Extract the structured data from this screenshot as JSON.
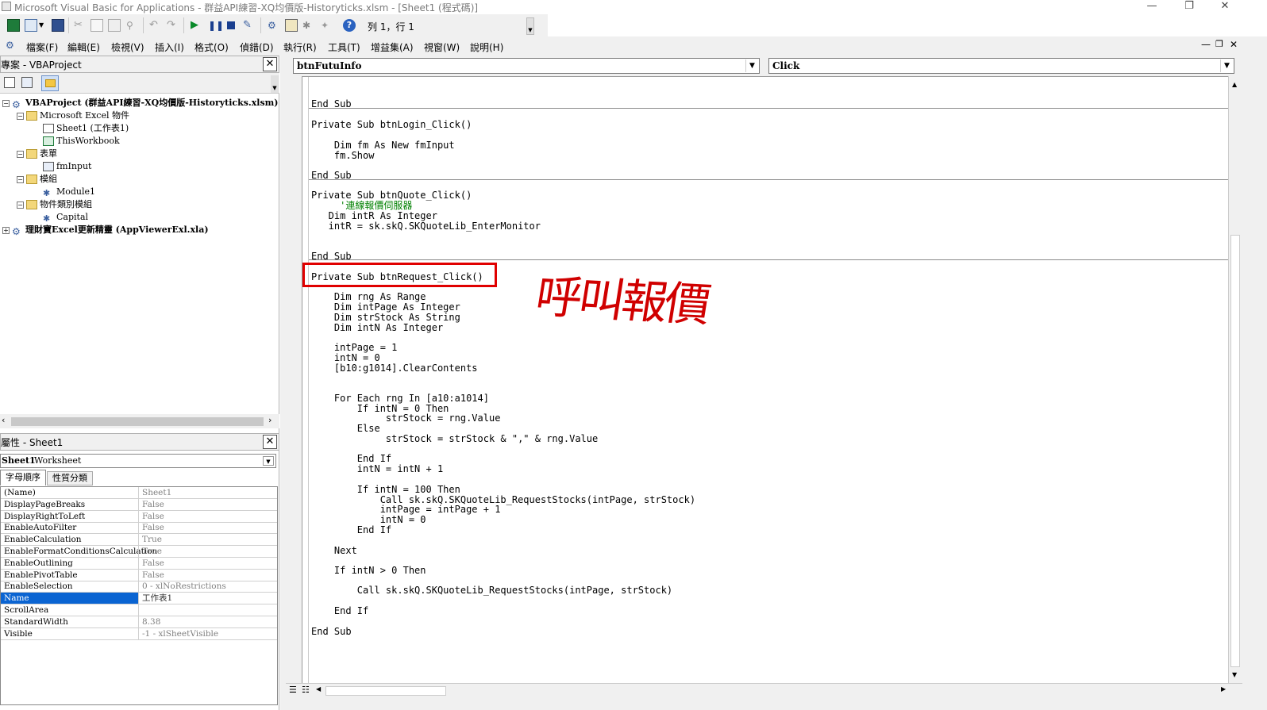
{
  "window": {
    "title": "Microsoft Visual Basic for Applications - 群益API練習-XQ均價版-Historyticks.xlsm - [Sheet1 (程式碼)]",
    "minimize": "—",
    "restore": "❐",
    "close": "✕"
  },
  "toolbar": {
    "position_label": "列 1，行 1"
  },
  "menu": {
    "items": [
      "檔案(F)",
      "編輯(E)",
      "檢視(V)",
      "插入(I)",
      "格式(O)",
      "偵錯(D)",
      "執行(R)",
      "工具(T)",
      "增益集(A)",
      "視窗(W)",
      "說明(H)"
    ]
  },
  "project_pane": {
    "title": "專案 - VBAProject",
    "tree": [
      {
        "label": "VBAProject (群益API練習-XQ均價版-Historyticks.xlsm)",
        "bold": true
      },
      {
        "label": "Microsoft Excel 物件"
      },
      {
        "label": "Sheet1 (工作表1)"
      },
      {
        "label": "ThisWorkbook"
      },
      {
        "label": "表單"
      },
      {
        "label": "fmInput"
      },
      {
        "label": "模組"
      },
      {
        "label": "Module1"
      },
      {
        "label": "物件類別模組"
      },
      {
        "label": "Capital"
      },
      {
        "label": "理財寶Excel更新精靈 (AppViewerExl.xla)",
        "bold": true
      }
    ]
  },
  "properties_pane": {
    "title": "屬性 - Sheet1",
    "object_name": "Sheet1",
    "object_type": "Worksheet",
    "tab_alpha": "字母順序",
    "tab_category": "性質分類",
    "rows": [
      {
        "name": "(Name)",
        "value": "Sheet1"
      },
      {
        "name": "DisplayPageBreaks",
        "value": "False"
      },
      {
        "name": "DisplayRightToLeft",
        "value": "False"
      },
      {
        "name": "EnableAutoFilter",
        "value": "False"
      },
      {
        "name": "EnableCalculation",
        "value": "True"
      },
      {
        "name": "EnableFormatConditionsCalculation",
        "value": "True"
      },
      {
        "name": "EnableOutlining",
        "value": "False"
      },
      {
        "name": "EnablePivotTable",
        "value": "False"
      },
      {
        "name": "EnableSelection",
        "value": "0 - xlNoRestrictions"
      },
      {
        "name": "Name",
        "value": "工作表1",
        "selected": true
      },
      {
        "name": "ScrollArea",
        "value": ""
      },
      {
        "name": "StandardWidth",
        "value": "8.38"
      },
      {
        "name": "Visible",
        "value": "-1 - xlSheetVisible"
      }
    ]
  },
  "code_window": {
    "object_combo": "btnFutuInfo",
    "procedure_combo": "Click",
    "annotation": "呼叫報價",
    "colors": {
      "highlight_box": "#e00000",
      "comment": "#008000",
      "annotation": "#d00000"
    },
    "lines": [
      {
        "text": "End Sub"
      },
      {
        "text": "Private Sub btnLogin_Click()"
      },
      {
        "text": "    Dim fm As New fmInput"
      },
      {
        "text": "    fm.Show"
      },
      {
        "text": "End Sub"
      },
      {
        "text": "Private Sub btnQuote_Click()"
      },
      {
        "text": "     '連線報價伺服器",
        "comment": true
      },
      {
        "text": "   Dim intR As Integer"
      },
      {
        "text": "   intR = sk.skQ.SKQuoteLib_EnterMonitor"
      },
      {
        "text": "End Sub"
      },
      {
        "text": "Private Sub btnRequest_Click()"
      },
      {
        "text": "    Dim rng As Range"
      },
      {
        "text": "    Dim intPage As Integer"
      },
      {
        "text": "    Dim strStock As String"
      },
      {
        "text": "    Dim intN As Integer"
      },
      {
        "text": "    intPage = 1"
      },
      {
        "text": "    intN = 0"
      },
      {
        "text": "    [b10:g1014].ClearContents"
      },
      {
        "text": "    For Each rng In [a10:a1014]"
      },
      {
        "text": "        If intN = 0 Then"
      },
      {
        "text": "             strStock = rng.Value"
      },
      {
        "text": "        Else"
      },
      {
        "text": "             strStock = strStock & \",\" & rng.Value"
      },
      {
        "text": "        End If"
      },
      {
        "text": "        intN = intN + 1"
      },
      {
        "text": "        If intN = 100 Then"
      },
      {
        "text": "            Call sk.skQ.SKQuoteLib_RequestStocks(intPage, strStock)"
      },
      {
        "text": "            intPage = intPage + 1"
      },
      {
        "text": "            intN = 0"
      },
      {
        "text": "        End If"
      },
      {
        "text": "    Next"
      },
      {
        "text": "    If intN > 0 Then"
      },
      {
        "text": "        Call sk.skQ.SKQuoteLib_RequestStocks(intPage, strStock)"
      },
      {
        "text": "    End If"
      },
      {
        "text": "End Sub"
      }
    ]
  }
}
